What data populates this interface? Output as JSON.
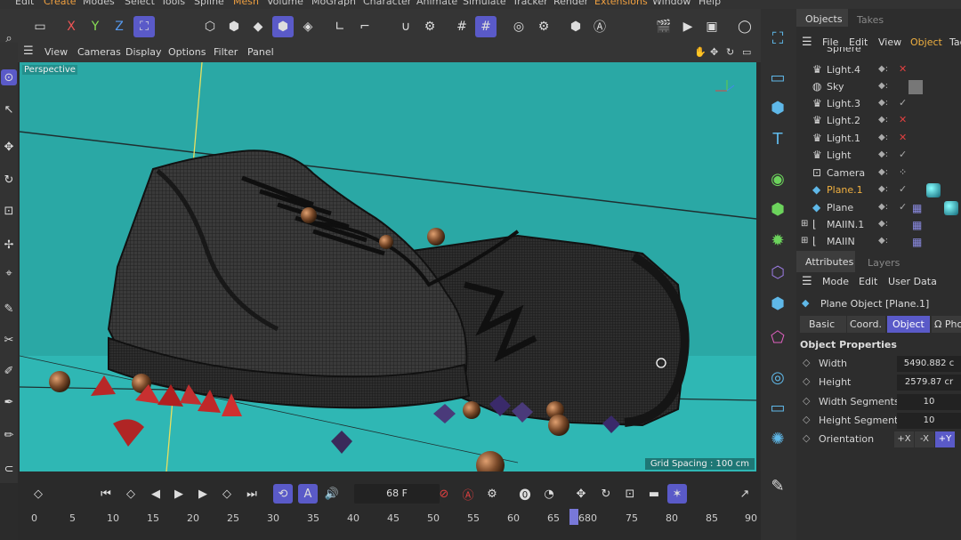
{
  "menu": [
    "Edit",
    "Create",
    "Modes",
    "Select",
    "Tools",
    "Spline",
    "Mesh",
    "Volume",
    "MoGraph",
    "Character",
    "Animate",
    "Simulate",
    "Tracker",
    "Render",
    "Extensions",
    "Window",
    "Help"
  ],
  "toolbar": {
    "axis_x": "X",
    "axis_y": "Y",
    "axis_z": "Z"
  },
  "viewport_menu": [
    "View",
    "Cameras",
    "Display",
    "Options",
    "Filter",
    "Panel"
  ],
  "viewport": {
    "label": "Perspective",
    "grid_spacing": "Grid Spacing : 100 cm"
  },
  "timeline": {
    "current_frame": "68 F",
    "ticks": [
      "0",
      "5",
      "10",
      "15",
      "20",
      "25",
      "30",
      "35",
      "40",
      "45",
      "50",
      "55",
      "60",
      "65",
      "680",
      "75",
      "80",
      "85",
      "90"
    ],
    "marker": "68"
  },
  "objects_panel": {
    "tabs": [
      "Objects",
      "Takes"
    ],
    "menu": [
      "File",
      "Edit",
      "View",
      "Object",
      "Tag"
    ],
    "rows": [
      {
        "name": "Sphere",
        "icon": "sphere-icon"
      },
      {
        "name": "Light.4",
        "icon": "light-icon"
      },
      {
        "name": "Sky",
        "icon": "sky-icon"
      },
      {
        "name": "Light.3",
        "icon": "light-icon"
      },
      {
        "name": "Light.2",
        "icon": "light-icon"
      },
      {
        "name": "Light.1",
        "icon": "light-icon"
      },
      {
        "name": "Light",
        "icon": "light-icon"
      },
      {
        "name": "Camera",
        "icon": "camera-icon"
      },
      {
        "name": "Plane.1",
        "icon": "plane-icon",
        "selected": true
      },
      {
        "name": "Plane",
        "icon": "plane-icon"
      },
      {
        "name": "MAIIN.1",
        "icon": "null-icon"
      },
      {
        "name": "MAIIN",
        "icon": "null-icon"
      }
    ]
  },
  "attributes_panel": {
    "tabs": [
      "Attributes",
      "Layers"
    ],
    "menu": [
      "Mode",
      "Edit",
      "User Data"
    ],
    "object_title": "Plane Object [Plane.1]",
    "subtabs": [
      "Basic",
      "Coord.",
      "Object",
      "Ω Phong"
    ],
    "section": "Object Properties",
    "fields": [
      {
        "label": "Width",
        "value": "5490.882 c"
      },
      {
        "label": "Height",
        "value": "2579.87 cr"
      },
      {
        "label": "Width Segments",
        "value": "10"
      },
      {
        "label": "Height Segments",
        "value": "10"
      },
      {
        "label": "Orientation",
        "value": ""
      }
    ],
    "orientation_buttons": [
      "+X",
      "-X",
      "+Y"
    ]
  },
  "colors": {
    "accent": "#5a5ac8",
    "viewport_bg": "#29a9a6",
    "selected_text": "#f0b040"
  }
}
